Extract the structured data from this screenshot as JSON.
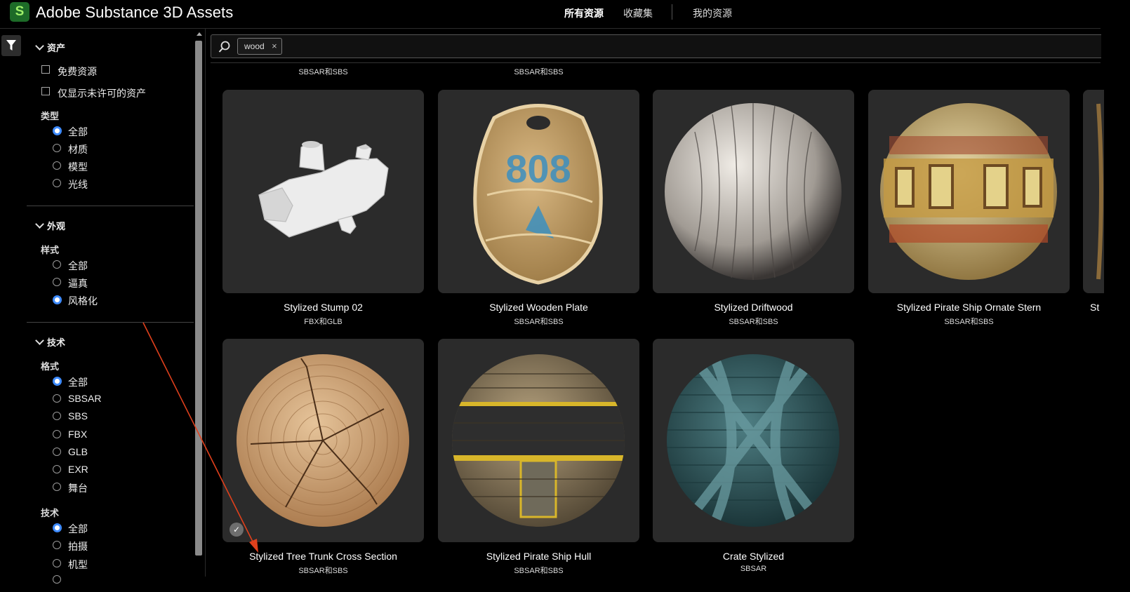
{
  "app": {
    "logo_letter": "S",
    "title": "Adobe Substance 3D Assets"
  },
  "nav": {
    "all_assets": "所有资源",
    "collections": "收藏集",
    "my_assets": "我的资源",
    "active": "all_assets"
  },
  "filters": {
    "assets": {
      "title": "资产",
      "checkboxes": [
        {
          "label": "免费资源",
          "checked": false
        },
        {
          "label": "仅显示未许可的资产",
          "checked": false
        }
      ],
      "type": {
        "title": "类型",
        "options": [
          "全部",
          "材质",
          "模型",
          "光线"
        ],
        "selected": "全部"
      }
    },
    "appearance": {
      "title": "外观",
      "style": {
        "title": "样式",
        "options": [
          "全部",
          "逼真",
          "风格化"
        ],
        "selected": "风格化"
      }
    },
    "technical": {
      "title": "技术",
      "format": {
        "title": "格式",
        "options": [
          "全部",
          "SBSAR",
          "SBS",
          "FBX",
          "GLB",
          "EXR",
          "舞台"
        ],
        "selected": "全部"
      },
      "technique": {
        "title": "技术",
        "options": [
          "全部",
          "拍摄",
          "机型"
        ],
        "selected": "全部"
      }
    }
  },
  "search": {
    "tag": "wood",
    "remove_symbol": "×"
  },
  "previous_row_formats": [
    "SBSAR和SBS",
    "SBSAR和SBS"
  ],
  "assets": [
    {
      "name": "Stylized Stump 02",
      "format": "FBX和GLB",
      "thumbnail": "white-stump-model",
      "selected": false
    },
    {
      "name": "Stylized Wooden Plate",
      "format": "SBSAR和SBS",
      "thumbnail": "wooden-plate-with-blue-paint",
      "selected": false
    },
    {
      "name": "Stylized Driftwood",
      "format": "SBSAR和SBS",
      "thumbnail": "driftwood-sphere",
      "selected": false
    },
    {
      "name": "Stylized Pirate Ship Ornate Stern",
      "format": "SBSAR和SBS",
      "thumbnail": "ornate-stern-sphere",
      "selected": false
    },
    {
      "name": "Stylized Tree Trunk Cross Section",
      "format": "SBSAR和SBS",
      "thumbnail": "tree-rings-sphere",
      "selected": true
    },
    {
      "name": "Stylized Pirate Ship Hull",
      "format": "SBSAR和SBS",
      "thumbnail": "ship-hull-sphere",
      "selected": false
    },
    {
      "name": "Crate Stylized",
      "format": "SBSAR",
      "thumbnail": "teal-crate-sphere",
      "selected": false
    }
  ],
  "partial_card_name": "St",
  "colors": {
    "accent": "#3e8bff",
    "card_bg": "#2b2b2b",
    "annotation_arrow": "#e0401c"
  },
  "check_symbol": "✓"
}
